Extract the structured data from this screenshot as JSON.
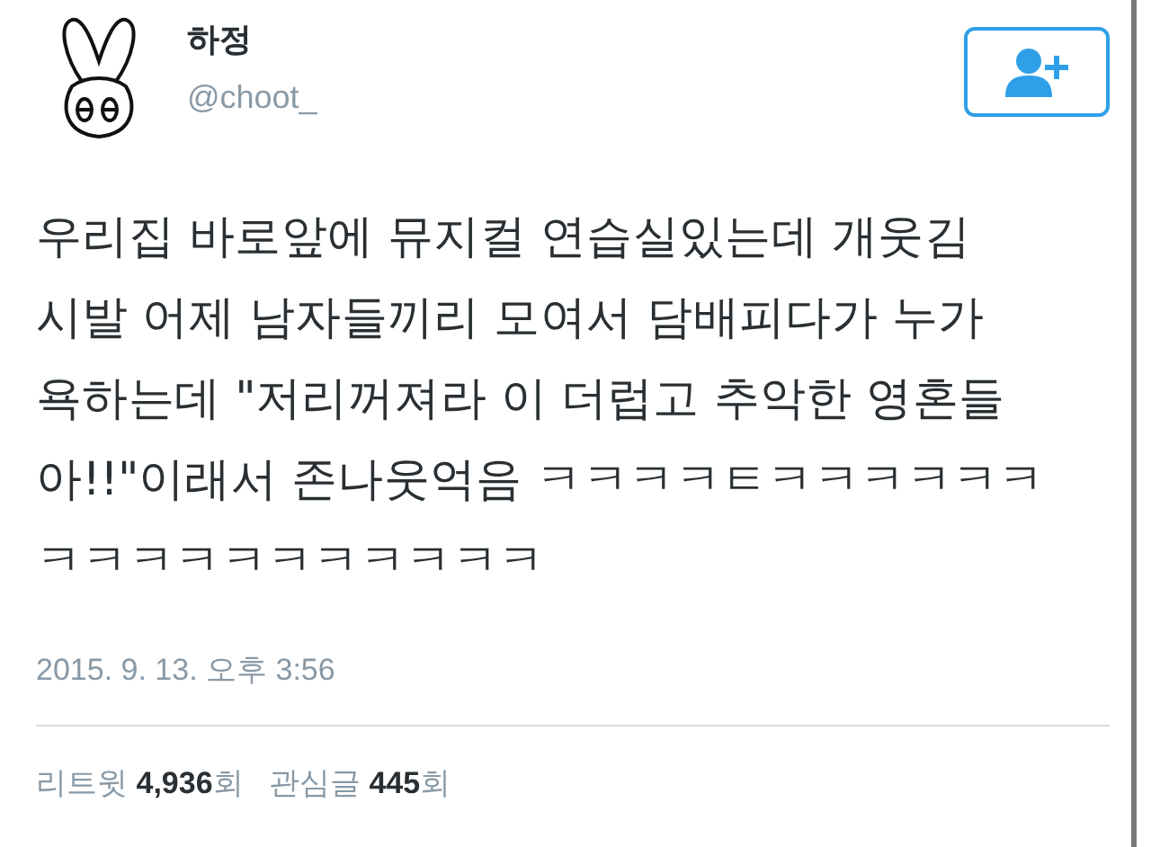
{
  "user": {
    "name": "하정",
    "handle": "@choot_"
  },
  "follow_button": {
    "kind": "follow"
  },
  "tweet": {
    "lines": [
      "우리집 바로앞에 뮤지컬 연습실있는데 개웃김",
      "시발 어제 남자들끼리 모여서 담배피다가 누가",
      "욕하는데 \"저리꺼져라 이 더럽고 추악한 영혼들",
      "아!!\"이래서 존나웃억음 ㅋㅋㅋㅋㅌㅋㅋㅋㅋㅋㅋ",
      "ㅋㅋㅋㅋㅋㅋㅋㅋㅋㅋㅋ"
    ]
  },
  "timestamp": "2015. 9. 13. 오후 3:56",
  "stats": "리트윗 **4,936**회   관심글 **445**회"
}
